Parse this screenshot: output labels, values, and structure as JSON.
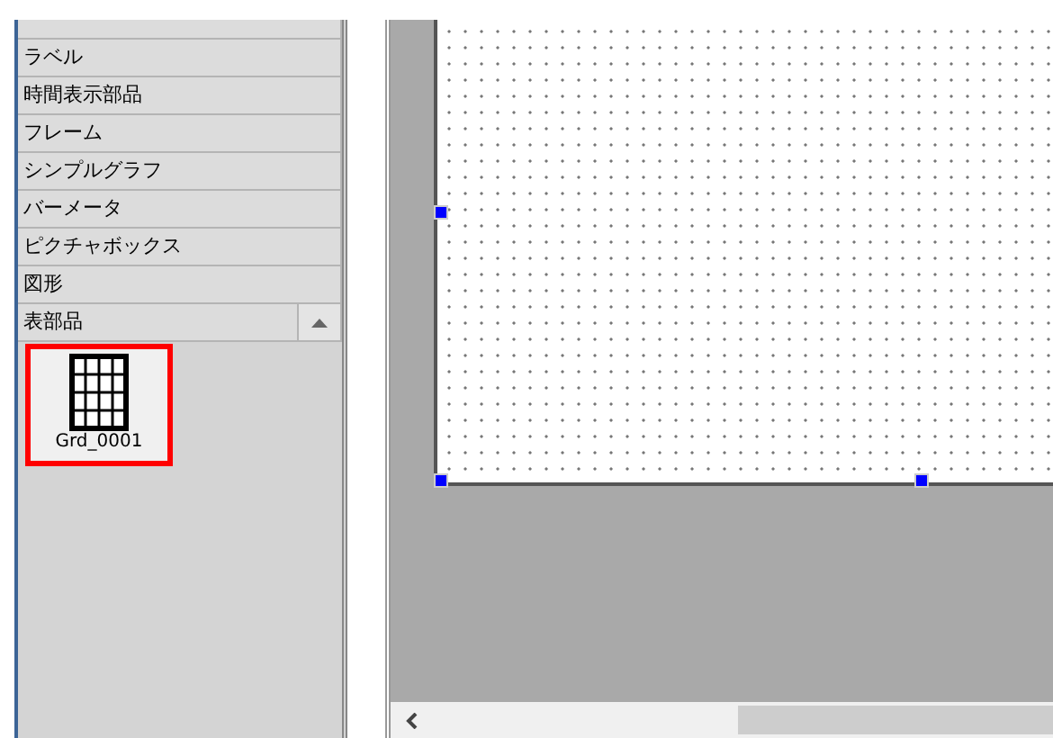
{
  "palette": {
    "categories": [
      {
        "label": "ラベル",
        "expanded": false
      },
      {
        "label": "時間表示部品",
        "expanded": false
      },
      {
        "label": "フレーム",
        "expanded": false
      },
      {
        "label": "シンプルグラフ",
        "expanded": false
      },
      {
        "label": "バーメータ",
        "expanded": false
      },
      {
        "label": "ピクチャボックス",
        "expanded": false
      },
      {
        "label": "図形",
        "expanded": false
      },
      {
        "label": "表部品",
        "expanded": true
      }
    ],
    "components": [
      {
        "label": "Grd_0001",
        "selected": true
      }
    ]
  }
}
